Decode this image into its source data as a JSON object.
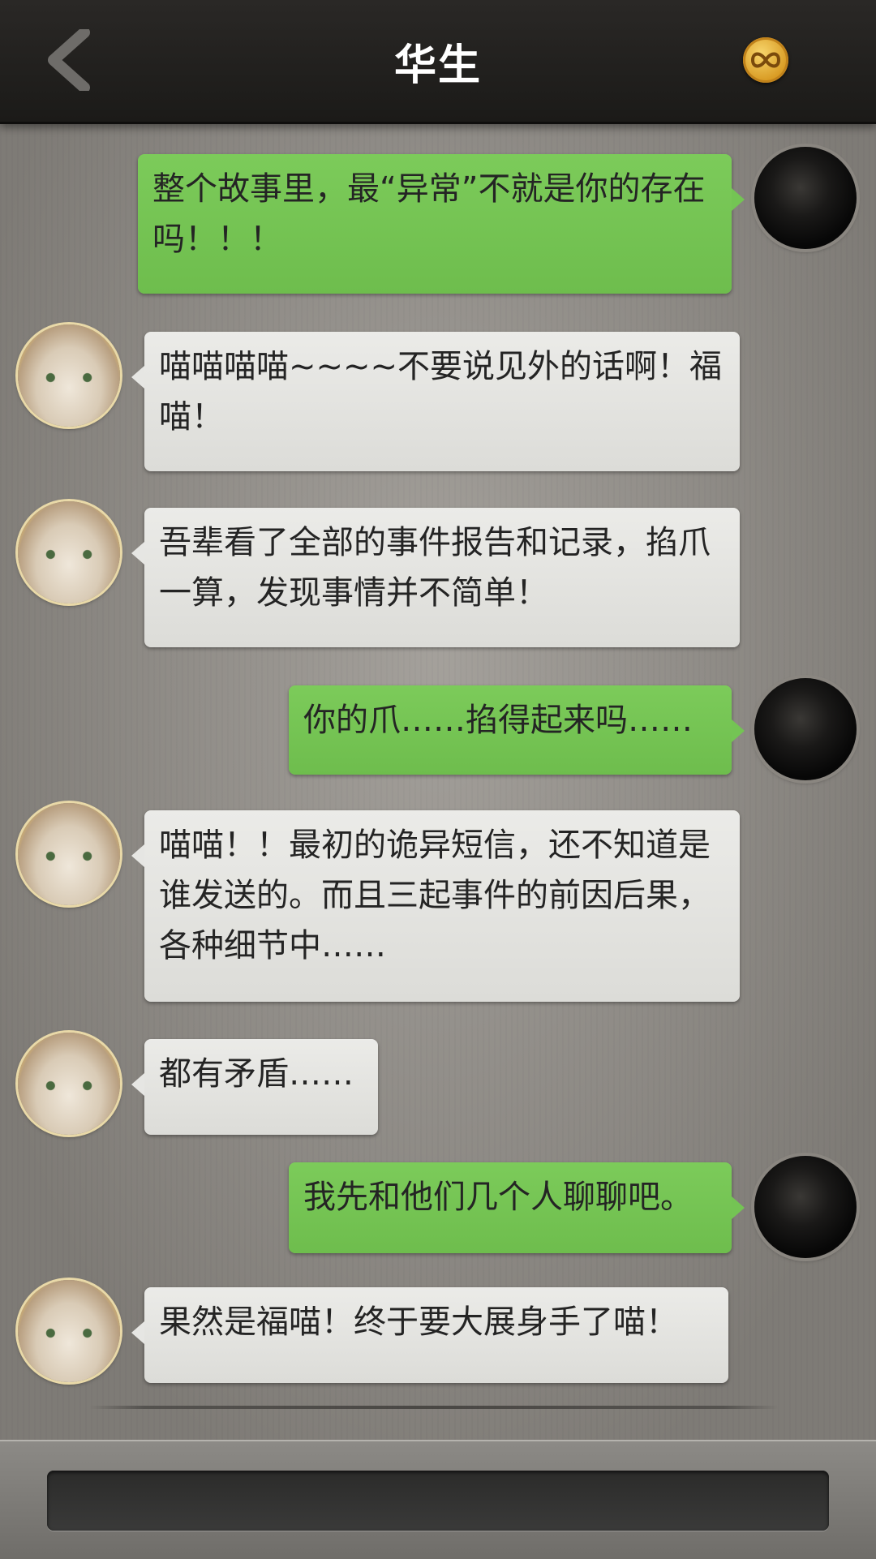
{
  "header": {
    "title": "华生"
  },
  "messages": [
    {
      "from": "me",
      "text": "整个故事里，最“异常”不就是你的存在吗！！！"
    },
    {
      "from": "them",
      "text": "喵喵喵喵~~~~不要说见外的话啊！福喵！"
    },
    {
      "from": "them",
      "text": "吾辈看了全部的事件报告和记录，掐爪一算，发现事情并不简单！"
    },
    {
      "from": "me",
      "text": "你的爪……掐得起来吗……"
    },
    {
      "from": "them",
      "text": "喵喵！！最初的诡异短信，还不知道是谁发送的。而且三起事件的前因后果，各种细节中……"
    },
    {
      "from": "them",
      "text": "都有矛盾……"
    },
    {
      "from": "me",
      "text": "我先和他们几个人聊聊吧。"
    },
    {
      "from": "them",
      "text": "果然是福喵！终于要大展身手了喵！"
    }
  ],
  "icons": {
    "back": "chevron-left-icon",
    "coin": "infinity-coin-icon"
  },
  "colors": {
    "my_bubble": "#74c454",
    "their_bubble": "#e6e6e3",
    "header": "#1f1e1c"
  }
}
